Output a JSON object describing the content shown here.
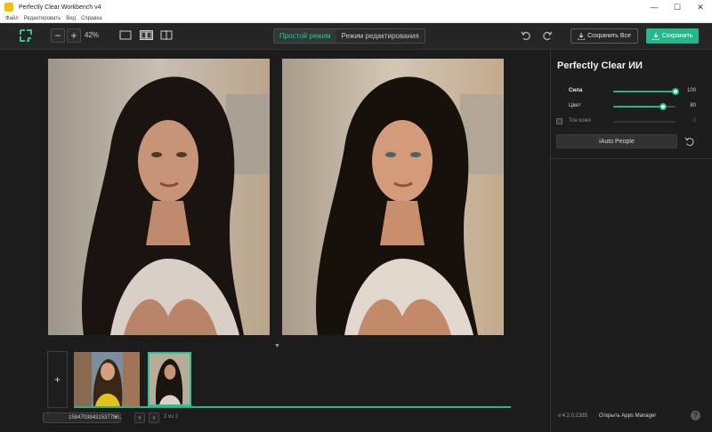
{
  "window": {
    "title": "Perfectly Clear Workbench v4",
    "controls": [
      "—",
      "☐",
      "✕"
    ]
  },
  "menu": [
    "Файл",
    "Редактировать",
    "Вид",
    "Справка"
  ],
  "toolbar": {
    "zoom_out": "−",
    "zoom_in": "+",
    "zoom_level": "42%",
    "mode_simple": "Простой режим",
    "mode_edit": "Режим редактирования",
    "save_all": "Сохранить Все",
    "save": "Сохранить"
  },
  "filmstrip": {
    "add_label": "+",
    "file_name": "15847038431537780..",
    "prev": "‹",
    "next": "›",
    "counter": "2 из 2",
    "collapse_icon": "▼"
  },
  "panel": {
    "title": "Perfectly Clear ИИ",
    "strength": {
      "label": "Сила",
      "value": 100,
      "display": "100"
    },
    "color": {
      "label": "Цвет",
      "value": 80,
      "display": "80"
    },
    "skin_tone": {
      "label": "Тон кожи",
      "value": 0,
      "display": "0",
      "checked": false
    },
    "auto_button": "iAuto People",
    "version": "v:4.2.0.2385",
    "apps_manager": "Открыть Apps Manager",
    "help": "?"
  },
  "colors": {
    "accent": "#22b88a",
    "active_text": "#2cc49d",
    "background": "#1f1f1f"
  }
}
